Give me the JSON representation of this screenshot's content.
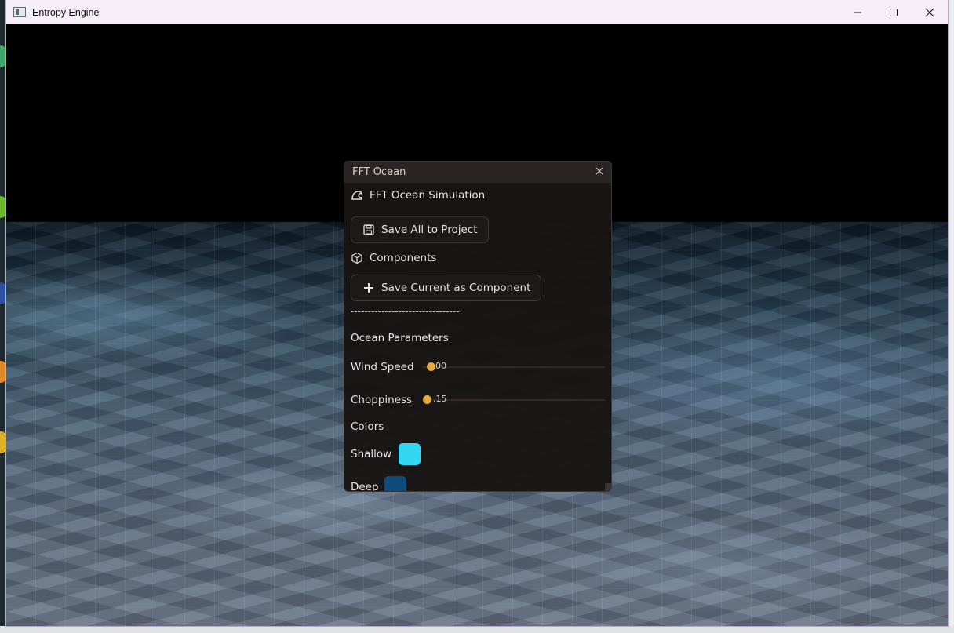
{
  "window": {
    "title": "Entropy Engine",
    "controls": [
      "minimize",
      "maximize",
      "close"
    ]
  },
  "panel": {
    "title": "FFT Ocean",
    "section_title": "FFT Ocean Simulation",
    "save_all_label": "Save All to Project",
    "components_label": "Components",
    "save_component_label": "Save Current as Component",
    "separator": "--------------------------------",
    "ocean_params_label": "Ocean Parameters",
    "wind_speed": {
      "label": "Wind Speed",
      "value_text": "00",
      "fraction": 0.02
    },
    "choppiness": {
      "label": "Choppiness",
      "value_text": ".15",
      "fraction": 0.0
    },
    "colors_label": "Colors",
    "shallow": {
      "label": "Shallow",
      "color": "#30d8f2"
    },
    "deep": {
      "label": "Deep",
      "color": "#0e4a7a"
    }
  },
  "accent_color": "#e7a83a"
}
